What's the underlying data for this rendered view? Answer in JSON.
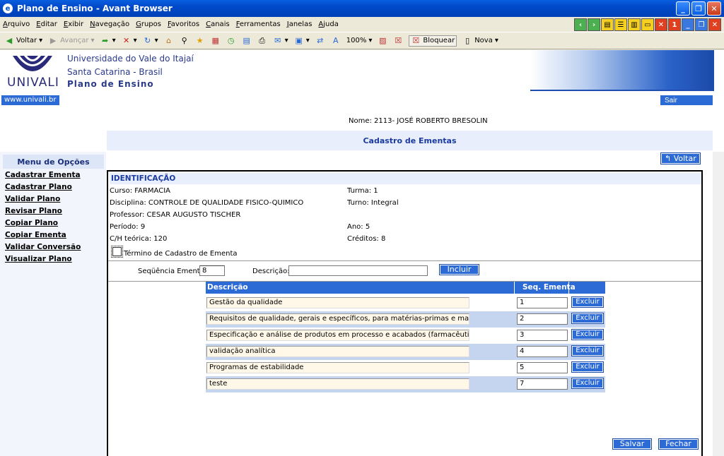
{
  "window": {
    "title": "Plano de Ensino - Avant Browser"
  },
  "menu": [
    "Arquivo",
    "Editar",
    "Exibir",
    "Navegação",
    "Grupos",
    "Favoritos",
    "Canais",
    "Ferramentas",
    "Janelas",
    "Ajuda"
  ],
  "toolbar": {
    "back": "Voltar",
    "forward": "Avançar",
    "zoom": "100%",
    "block": "Bloquear",
    "new": "Nova"
  },
  "header": {
    "logo": "UNIVALI",
    "university": "Universidade do Vale do Itajaí",
    "state": "Santa Catarina - Brasil",
    "system": "Plano de Ensino",
    "site": "www.univali.br",
    "logout": "Sair"
  },
  "user": {
    "name": "Nome: 2113- JOSÉ ROBERTO BRESOLIN"
  },
  "section_title": "Cadastro de Ementas",
  "back_button": "↰ Voltar",
  "sidebar": {
    "title": "Menu de Opções",
    "items": [
      "Cadastrar Ementa",
      "Cadastrar Plano",
      "Validar Plano",
      "Revisar Plano",
      "Copiar Plano",
      "Copiar Ementa",
      "Validar Conversão",
      "Visualizar Plano"
    ]
  },
  "ident": {
    "title": "IDENTIFICAÇÃO",
    "curso": "Curso: FARMACIA",
    "turma": "Turma: 1",
    "disciplina": "Disciplina: CONTROLE DE QUALIDADE FISICO-QUIMICO",
    "turno": "Turno: Integral",
    "professor": "Professor: CESAR AUGUSTO TISCHER",
    "periodo": "Período: 9",
    "ano": "Ano: 5",
    "ch": "C/H teórica: 120",
    "creditos": "Créditos: 8",
    "termino": "Término de Cadastro de Ementa"
  },
  "form": {
    "seq_label": "Seqüência Ementa:",
    "seq_value": "8",
    "desc_label": "Descrição:",
    "desc_value": "",
    "add": "Incluir"
  },
  "grid": {
    "col_desc": "Descrição",
    "col_seq": "Seq. Ementa",
    "delete_label": "Excluir",
    "rows": [
      {
        "desc": "Gestão da qualidade",
        "seq": "1"
      },
      {
        "desc": "Requisitos de qualidade, gerais e específicos, para matérias-primas e materiais de emb",
        "seq": "2"
      },
      {
        "desc": "Especificação e análise de produtos em processo e acabados (farmacêuticos e cosméti",
        "seq": "3"
      },
      {
        "desc": "validação analítica",
        "seq": "4"
      },
      {
        "desc": "Programas de estabilidade",
        "seq": "5"
      },
      {
        "desc": "teste",
        "seq": "7"
      }
    ]
  },
  "actions": {
    "save": "Salvar",
    "close": "Fechar"
  }
}
